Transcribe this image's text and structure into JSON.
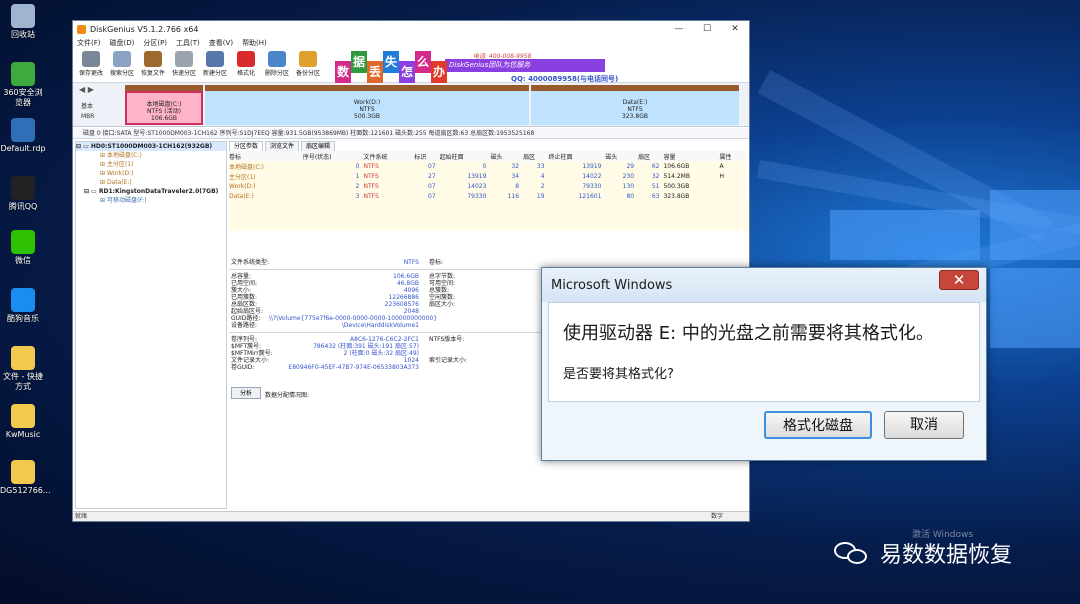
{
  "desktop": {
    "icons": [
      {
        "label": "回收站",
        "icon": "recycle-bin-icon",
        "color": "#9fb4cf"
      },
      {
        "label": "360安全浏览器",
        "icon": "browser-360-icon",
        "color": "#3caa3c"
      },
      {
        "label": "Default.rdp",
        "icon": "remote-desktop-icon",
        "color": "#2f6fb8"
      },
      {
        "label": "腾讯QQ",
        "icon": "qq-icon",
        "color": "#222222"
      },
      {
        "label": "微信",
        "icon": "wechat-icon",
        "color": "#2dc100"
      },
      {
        "label": "酷狗音乐",
        "icon": "kugou-icon",
        "color": "#1a8ef0"
      },
      {
        "label": "文件 - 快捷方式",
        "icon": "file-shortcut-icon",
        "color": "#f2c94c"
      },
      {
        "label": "KwMusic",
        "icon": "folder-icon",
        "color": "#f2c94c"
      },
      {
        "label": "DG512766...",
        "icon": "folder-icon",
        "color": "#f2c94c"
      }
    ],
    "activate_text": "激活 Windows",
    "watermark": "易数数据恢复"
  },
  "app": {
    "title": "DiskGenius V5.1.2.766 x64",
    "menu": [
      "文件(F)",
      "磁盘(D)",
      "分区(P)",
      "工具(T)",
      "查看(V)",
      "帮助(H)"
    ],
    "toolbar": [
      {
        "label": "保存更改",
        "icon": "save-icon",
        "color": "#7a8799"
      },
      {
        "label": "搜索分区",
        "icon": "search-icon",
        "color": "#8aa2c4"
      },
      {
        "label": "恢复文件",
        "icon": "recover-icon",
        "color": "#9c6a2c"
      },
      {
        "label": "快速分区",
        "icon": "quick-partition-icon",
        "color": "#9aa3ad"
      },
      {
        "label": "新建分区",
        "icon": "new-partition-icon",
        "color": "#5577aa"
      },
      {
        "label": "格式化",
        "icon": "format-icon",
        "color": "#d92b2b"
      },
      {
        "label": "删除分区",
        "icon": "delete-icon",
        "color": "#4a86c8"
      },
      {
        "label": "备份分区",
        "icon": "backup-icon",
        "color": "#e0a030"
      }
    ],
    "banner": {
      "chars": [
        "数",
        "据",
        "丢",
        "失",
        "怎",
        "么",
        "办"
      ],
      "char_colors": [
        "#d42a8a",
        "#2d9a3f",
        "#e0662a",
        "#1e7dd8",
        "#8a3fe0",
        "#d42a8a",
        "#e03a2a"
      ],
      "bar_text": "DiskGenius团队为您服务",
      "phone": "电话: 400-008-9958",
      "qq": "QQ: 4000089958(与电话同号)"
    },
    "diskmap": {
      "label_basic": "基本",
      "label_mbr": "MBR",
      "partitions": [
        {
          "name": "本地磁盘(C:)",
          "fs": "NTFS (活动)",
          "size": "106.6GB",
          "color": "#ffb3c8"
        },
        {
          "name": "Work(D:)",
          "fs": "NTFS",
          "size": "500.3GB",
          "color": "#bfe3ff"
        },
        {
          "name": "Data(E:)",
          "fs": "NTFS",
          "size": "323.8GB",
          "color": "#bfe3ff"
        }
      ],
      "info": "磁盘 0  接口:SATA  型号:ST1000DM003-1CH162  序列号:S1DJ7EEQ  容量:931.5GB(953869MB)  柱面数:121601  磁头数:255  每道扇区数:63  总扇区数:1953525168"
    },
    "tree": {
      "disk0": "HD0:ST1000DM003-1CH162(932GB)",
      "disk0_parts": [
        "本地磁盘(C:)",
        "主分区(1)",
        "Work(D:)",
        "Data(E:)"
      ],
      "disk1": "RD1:KingstonDataTraveler2.0(7GB)",
      "disk1_parts": [
        "可移动磁盘(F:)"
      ]
    },
    "tabs": [
      "分区参数",
      "浏览文件",
      "扇区编辑"
    ],
    "table": {
      "headers": [
        "卷标",
        "序号(状态)",
        "文件系统",
        "标识",
        "起始柱面",
        "磁头",
        "扇区",
        "终止柱面",
        "磁头",
        "扇区",
        "容量",
        "属性"
      ],
      "rows": [
        [
          "本地磁盘(C:)",
          "0",
          "NTFS",
          "07",
          "0",
          "32",
          "33",
          "13919",
          "29",
          "62",
          "106.6GB",
          "A"
        ],
        [
          "主分区(1)",
          "1",
          "NTFS",
          "27",
          "13919",
          "34",
          "4",
          "14022",
          "230",
          "32",
          "514.2MB",
          "H"
        ],
        [
          "Work(D:)",
          "2",
          "NTFS",
          "07",
          "14023",
          "8",
          "2",
          "79330",
          "130",
          "51",
          "500.3GB",
          ""
        ],
        [
          "Data(E:)",
          "3",
          "NTFS",
          "07",
          "79330",
          "116",
          "19",
          "121601",
          "80",
          "63",
          "323.8GB",
          ""
        ]
      ]
    },
    "fsinfo": {
      "fs_type_label": "文件系统类型:",
      "fs_type": "NTFS",
      "vol_label": "卷标:",
      "rows1": [
        {
          "k": "总容量:",
          "v": "106.6GB",
          "k2": "总字节数:",
          "v2": "114487539712"
        },
        {
          "k": "已用空间:",
          "v": "46.8GB",
          "k2": "可用空间:",
          "v2": "59.8GB"
        },
        {
          "k": "簇大小:",
          "v": "4096",
          "k2": "总簇数:",
          "v2": ""
        },
        {
          "k": "已用簇数:",
          "v": "12266886",
          "k2": "空闲簇数:",
          "v2": ""
        },
        {
          "k": "总扇区数:",
          "v": "223608576",
          "k2": "扇区大小:",
          "v2": ""
        },
        {
          "k": "起始扇区号:",
          "v": "2048",
          "k2": "",
          "v2": ""
        },
        {
          "k": "GUID路径:",
          "v": "\\\\?\\Volume{775e7f6e-0000-0000-0000-100000000000}",
          "k2": "",
          "v2": ""
        },
        {
          "k": "设备路径:",
          "v": "\\Device\\HarddiskVolume1",
          "k2": "",
          "v2": ""
        }
      ],
      "rows2": [
        {
          "k": "卷序列号:",
          "v": "A8C6-1276-C6C2-2FC1",
          "k2": "NTFS版本号:",
          "v2": ""
        },
        {
          "k": "$MFT簇号:",
          "v": "786432 (柱面:391 磁头:191 扇区:57)",
          "k2": "",
          "v2": ""
        },
        {
          "k": "$MFTMirr簇号:",
          "v": "2 (柱面:0 磁头:32 扇区:49)",
          "k2": "",
          "v2": ""
        },
        {
          "k": "文件记录大小:",
          "v": "1024",
          "k2": "索引记录大小:",
          "v2": ""
        },
        {
          "k": "卷GUID:",
          "v": "E80946F0-45EF-47B7-974E-06533803A373",
          "k2": "",
          "v2": ""
        }
      ],
      "analyze_btn": "分析",
      "analyze_label": "数据分配情况图:"
    },
    "status": {
      "left": "就绪",
      "right": "数字"
    }
  },
  "dialog": {
    "title": "Microsoft Windows",
    "close": "✕",
    "message": "使用驱动器 E: 中的光盘之前需要将其格式化。",
    "question": "是否要将其格式化?",
    "ok": "格式化磁盘",
    "cancel": "取消"
  }
}
